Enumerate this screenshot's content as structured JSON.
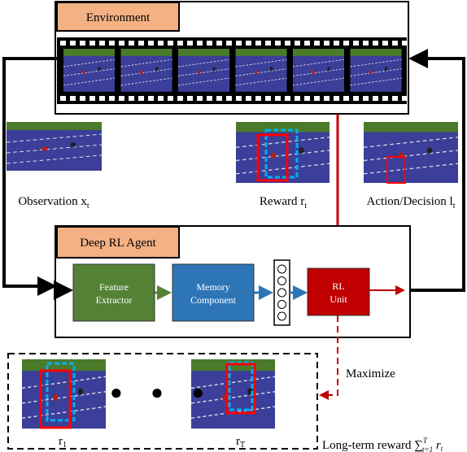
{
  "environment": {
    "label": "Environment",
    "frames": 6
  },
  "observation": {
    "label": "Observation x",
    "sub": "t"
  },
  "reward": {
    "label": "Reward r",
    "sub": "t"
  },
  "action": {
    "label": "Action/Decision l",
    "sub": "t"
  },
  "agent": {
    "label": "Deep RL Agent",
    "feature": [
      "Feature",
      "Extractor"
    ],
    "memory": [
      "Memory",
      "Component"
    ],
    "rl": [
      "RL",
      "Unit"
    ]
  },
  "maximize": "Maximize",
  "rewards": {
    "first": "r",
    "first_sub": "1",
    "last": "r",
    "last_sub": "T",
    "dots": "● ● ●"
  },
  "long_term": {
    "label": "Long-term reward ",
    "formula": "∑",
    "sup": "T",
    "sub": "t=1",
    "term": " r",
    "term_sub": "t"
  },
  "colors": {
    "orange": "#f4b183",
    "green": "#548235",
    "blue": "#2e75b6",
    "red": "#c00000",
    "cyan": "#00b0f0",
    "track": "#3b3f9a"
  }
}
